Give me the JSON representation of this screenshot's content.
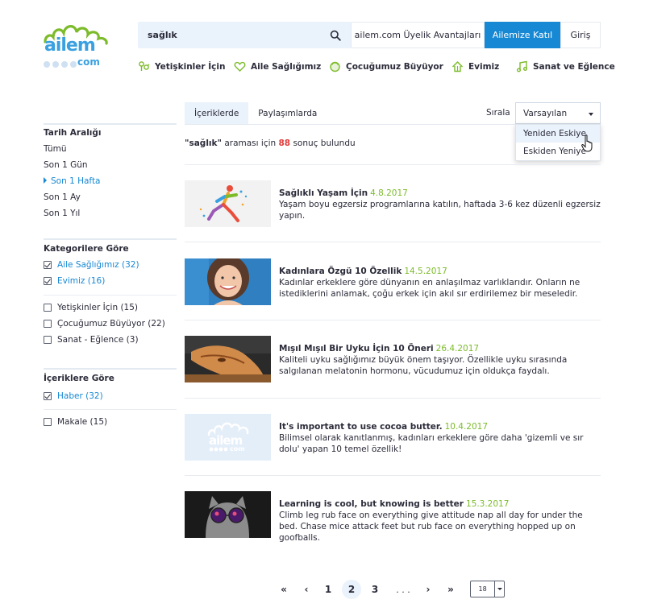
{
  "brand": {
    "logo_text": "ailem",
    "logo_sub": "com"
  },
  "header": {
    "search_value": "sağlık",
    "advantages_label": "ailem.com Üyelik Avantajları",
    "join_label": "Ailemize Katıl",
    "login_label": "Giriş"
  },
  "nav": [
    {
      "label": "Yetişkinler İçin",
      "icon": "adults-icon"
    },
    {
      "label": "Aile Sağlığımız",
      "icon": "heart-icon"
    },
    {
      "label": "Çocuğumuz Büyüyor",
      "icon": "child-icon"
    },
    {
      "label": "Evimiz",
      "icon": "house-icon"
    },
    {
      "label": "Sanat ve Eğlence",
      "icon": "music-note-icon"
    }
  ],
  "sidebar": {
    "date_title": "Tarih Aralığı",
    "dates": [
      "Tümü",
      "Son 1 Gün",
      "Son 1 Hafta",
      "Son 1 Ay",
      "Son 1 Yıl"
    ],
    "active_date": "Son 1 Hafta",
    "category_title": "Kategorilere Göre",
    "categories_checked": [
      "Aile Sağlığımız (32)",
      "Evimiz (16)"
    ],
    "categories_unchecked": [
      "Yetişkinler İçin (15)",
      "Çocuğumuz Büyüyor (22)",
      "Sanat - Eğlence (3)"
    ],
    "content_title": "İçeriklere Göre",
    "contents_checked": [
      "Haber (32)"
    ],
    "contents_unchecked": [
      "Makale (15)"
    ]
  },
  "tabs": [
    "İçeriklerde",
    "Paylaşımlarda"
  ],
  "sort": {
    "label": "Sırala",
    "selected": "Varsayılan",
    "options": [
      "Yeniden Eskiye",
      "Eskiden Yeniye"
    ]
  },
  "results": {
    "query": "\"sağlık\"",
    "middle": " araması için ",
    "count": "88",
    "suffix": " sonuç bulundu"
  },
  "items": [
    {
      "title": "Sağlıklı Yaşam İçin",
      "date": "4.8.2017",
      "desc": "Yaşam boyu  egzersiz programlarına katılın, haftada 3-6 kez düzenli egzersiz yapın."
    },
    {
      "title": "Kadınlara Özgü 10 Özellik",
      "date": "14.5.2017",
      "desc": "Kadınlar erkeklere göre dünyanın en anlaşılmaz varlıklarıdır. Onların ne istediklerini anlamak, çoğu erkek için akıl sır erdirilemez bir meseledir."
    },
    {
      "title": "Mışıl Mışıl Bir Uyku İçin 10 Öneri",
      "date": "26.4.2017",
      "desc": "Kaliteli uyku sağlığımız büyük önem taşıyor. Özellikle uyku sırasında salgılanan melatonin hormonu, vücudumuz için oldukça faydalı."
    },
    {
      "title": "It's important to use cocoa butter.",
      "date": "10.4.2017",
      "desc": "Bilimsel olarak kanıtlanmış, kadınları erkeklere göre daha 'gizemli ve sır dolu' yapan 10 temel özellik!"
    },
    {
      "title": "Learning is cool, but knowing is better",
      "date": "15.3.2017",
      "desc": "Climb leg rub face on everything give attitude nap all day for under the bed. Chase mice attack feet but rub face on everything hopped up on goofballs."
    }
  ],
  "pagination": {
    "first": "«",
    "prev": "‹",
    "pages": [
      "1",
      "2",
      "3"
    ],
    "active": "2",
    "ellipsis": ". . .",
    "next": "›",
    "last": "»",
    "per_page": "18"
  },
  "colors": {
    "accent": "#1688d4",
    "green": "#7cbb2a",
    "highlight": "#e23b3b",
    "soft_blue": "#eaf2fc"
  }
}
